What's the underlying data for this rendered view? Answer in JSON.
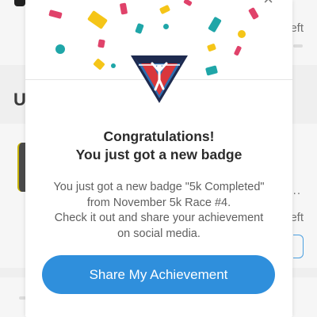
{
  "background": {
    "right_label_top": "eft",
    "right_label_mid": "eft",
    "right_dots": "...",
    "left_heading_letter": "U"
  },
  "modal": {
    "close_icon": "close-icon",
    "badge_icon": "runner-finish-badge-icon",
    "title_line1": "Congratulations!",
    "title_line2": "You just got a new badge",
    "description_line1": "You just got a new badge \"5k Completed\"",
    "description_line2": "from November 5k Race #4.",
    "description_line3": "Check it out and share your achievement",
    "description_line4": "on social media.",
    "share_button_label": "Share My Achievement"
  },
  "colors": {
    "accent": "#2f8fdc",
    "badge_navy": "#1e2a4f",
    "badge_red": "#d9373c",
    "badge_blue": "#2f6fb2"
  }
}
